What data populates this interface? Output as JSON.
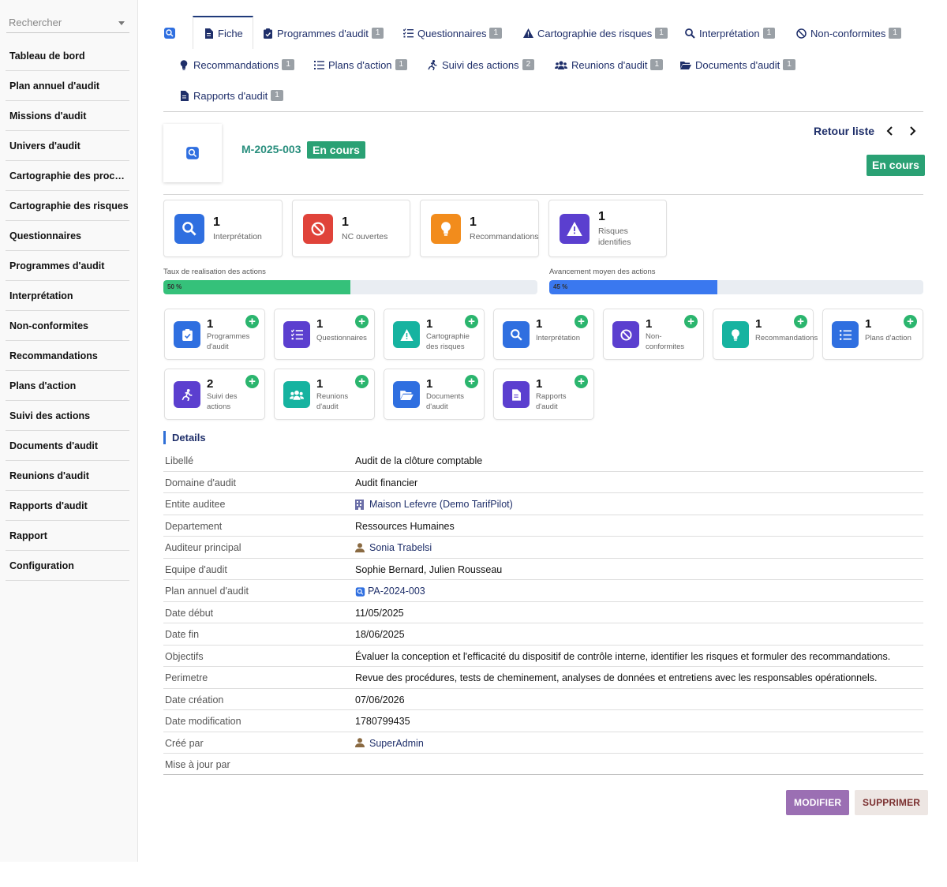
{
  "search": {
    "placeholder": "Rechercher"
  },
  "sidebar": {
    "items": [
      {
        "label": "Tableau de bord"
      },
      {
        "label": "Plan annuel d'audit"
      },
      {
        "label": "Missions d'audit"
      },
      {
        "label": "Univers d'audit"
      },
      {
        "label": "Cartographie des processus"
      },
      {
        "label": "Cartographie des risques"
      },
      {
        "label": "Questionnaires"
      },
      {
        "label": "Programmes d'audit"
      },
      {
        "label": "Interprétation"
      },
      {
        "label": "Non-conformites"
      },
      {
        "label": "Recommandations"
      },
      {
        "label": "Plans d'action"
      },
      {
        "label": "Suivi des actions"
      },
      {
        "label": "Documents d'audit"
      },
      {
        "label": "Reunions d'audit"
      },
      {
        "label": "Rapports d'audit"
      },
      {
        "label": "Rapport"
      },
      {
        "label": "Configuration"
      }
    ]
  },
  "tabs": [
    {
      "label": "Fiche",
      "count": ""
    },
    {
      "label": "Programmes d'audit",
      "count": "1"
    },
    {
      "label": "Questionnaires",
      "count": "1"
    },
    {
      "label": "Cartographie des risques",
      "count": "1"
    },
    {
      "label": "Interprétation",
      "count": "1"
    },
    {
      "label": "Non-conformites",
      "count": "1"
    },
    {
      "label": "Recommandations",
      "count": "1"
    },
    {
      "label": "Plans d'action",
      "count": "1"
    },
    {
      "label": "Suivi des actions",
      "count": "2"
    },
    {
      "label": "Reunions d'audit",
      "count": "1"
    },
    {
      "label": "Documents d'audit",
      "count": "1"
    },
    {
      "label": "Rapports d'audit",
      "count": "1"
    }
  ],
  "record": {
    "ref": "M-2025-003",
    "status": "En cours",
    "back_label": "Retour liste",
    "status_right": "En cours"
  },
  "stats": [
    {
      "value": "1",
      "label": "Interprétation",
      "color": "#2f6fe0",
      "icon": "search-icon"
    },
    {
      "value": "1",
      "label": "NC ouvertes",
      "color": "#e0433a",
      "icon": "ban-icon"
    },
    {
      "value": "1",
      "label": "Recommandations",
      "color": "#f28c1c",
      "icon": "lightbulb-icon"
    },
    {
      "value": "1",
      "label": "Risques identifies",
      "color": "#5b3fcf",
      "icon": "warning-icon"
    }
  ],
  "progress": [
    {
      "label": "Taux de realisation des actions",
      "value": 50,
      "text": "50 %",
      "color": "#35c17a"
    },
    {
      "label": "Avancement moyen des actions",
      "value": 45,
      "text": "45 %",
      "color": "#3a78ef"
    }
  ],
  "modules": [
    {
      "value": "1",
      "label": "Programmes d'audit",
      "color": "#2f6fe0",
      "icon": "clipboard-check-icon"
    },
    {
      "value": "1",
      "label": "Questionnaires",
      "color": "#5b3fcf",
      "icon": "tasks-icon"
    },
    {
      "value": "1",
      "label": "Cartographie des risques",
      "color": "#16b3a0",
      "icon": "warning-icon"
    },
    {
      "value": "1",
      "label": "Interprétation",
      "color": "#2f6fe0",
      "icon": "search-icon"
    },
    {
      "value": "1",
      "label": "Non-conformites",
      "color": "#5b3fcf",
      "icon": "ban-icon"
    },
    {
      "value": "1",
      "label": "Recommandations",
      "color": "#16b3a0",
      "icon": "lightbulb-icon"
    },
    {
      "value": "1",
      "label": "Plans d'action",
      "color": "#2f6fe0",
      "icon": "list-icon"
    },
    {
      "value": "2",
      "label": "Suivi des actions",
      "color": "#5b3fcf",
      "icon": "running-icon"
    },
    {
      "value": "1",
      "label": "Reunions d'audit",
      "color": "#16b3a0",
      "icon": "users-icon"
    },
    {
      "value": "1",
      "label": "Documents d'audit",
      "color": "#2f6fe0",
      "icon": "folder-icon"
    },
    {
      "value": "1",
      "label": "Rapports d'audit",
      "color": "#5b3fcf",
      "icon": "file-icon"
    }
  ],
  "details": {
    "title": "Details",
    "rows": [
      {
        "key": "Libellé",
        "value": "Audit de la clôture comptable"
      },
      {
        "key": "Domaine d'audit",
        "value": "Audit financier"
      },
      {
        "key": "Entite auditee",
        "value": "Maison Lefevre (Demo TarifPilot)",
        "icon": "building-icon"
      },
      {
        "key": "Departement",
        "value": "Ressources Humaines"
      },
      {
        "key": "Auditeur principal",
        "value": "Sonia Trabelsi",
        "icon": "user-icon"
      },
      {
        "key": "Equipe d'audit",
        "value": "Sophie Bernard, Julien Rousseau"
      },
      {
        "key": "Plan annuel d'audit",
        "value": "PA-2024-003",
        "icon": "audit-plan-icon"
      },
      {
        "key": "Date début",
        "value": "11/05/2025"
      },
      {
        "key": "Date fin",
        "value": "18/06/2025"
      },
      {
        "key": "Objectifs",
        "value": "Évaluer la conception et l'efficacité du dispositif de contrôle interne, identifier les risques et formuler des recommandations."
      },
      {
        "key": "Perimetre",
        "value": "Revue des procédures, tests de cheminement, analyses de données et entretiens avec les responsables opérationnels."
      },
      {
        "key": "Date création",
        "value": "07/06/2026"
      },
      {
        "key": "Date modification",
        "value": "1780799435"
      },
      {
        "key": "Créé par",
        "value": "SuperAdmin",
        "icon": "user-icon"
      },
      {
        "key": "Mise à jour par",
        "value": ""
      }
    ]
  },
  "actions": {
    "edit_label": "MODIFIER",
    "delete_label": "SUPPRIMER"
  }
}
